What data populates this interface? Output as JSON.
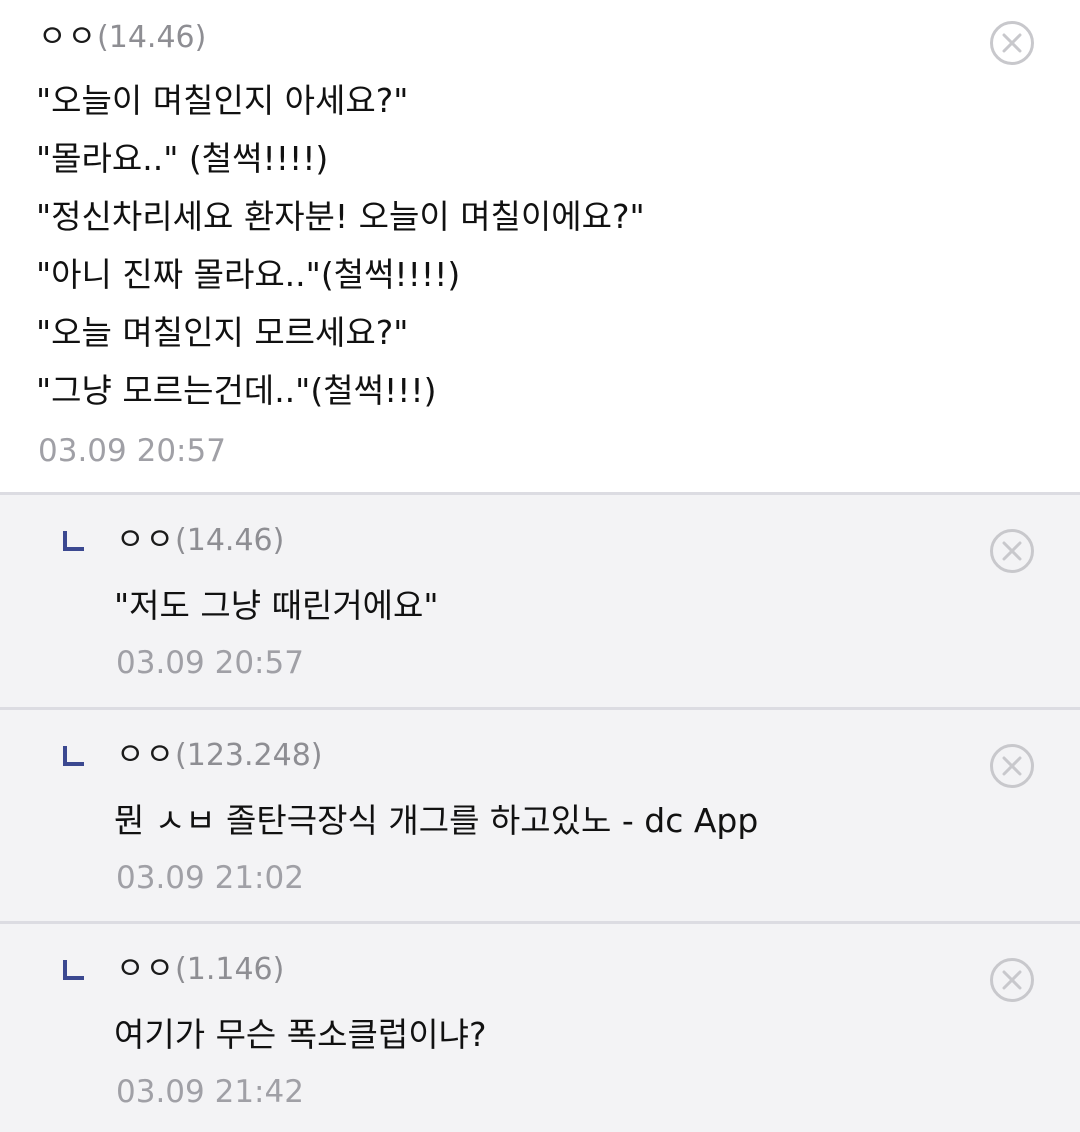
{
  "comments": [
    {
      "author": "ㅇㅇ",
      "ip": "(14.46)",
      "lines": [
        "\"오늘이 며칠인지 아세요?\"",
        "\"몰라요..\" (철썩!!!!)",
        "\"정신차리세요 환자분! 오늘이 며칠이에요?\"",
        "\"아니 진짜 몰라요..\"(철썩!!!!)",
        "\"오늘 며칠인지 모르세요?\"",
        "\"그냥 모르는건데..\"(철썩!!!)"
      ],
      "time": "03.09 20:57"
    }
  ],
  "replies": [
    {
      "author": "ㅇㅇ",
      "ip": "(14.46)",
      "text": "\"저도 그냥 때린거에요\"",
      "time": "03.09 20:57"
    },
    {
      "author": "ㅇㅇ",
      "ip": "(123.248)",
      "text": "뭔 ㅅㅂ 졸탄극장식 개그를 하고있노 - dc App",
      "time": "03.09 21:02"
    },
    {
      "author": "ㅇㅇ",
      "ip": "(1.146)",
      "text": "여기가 무슨 폭소클럽이냐?",
      "time": "03.09 21:42"
    }
  ],
  "icons": {
    "delete": "close-circle-icon",
    "reply": "reply-arrow-icon"
  },
  "colors": {
    "reply_background": "#f3f3f5",
    "reply_marker": "#3b4890",
    "meta_text": "#a0a0a6"
  }
}
